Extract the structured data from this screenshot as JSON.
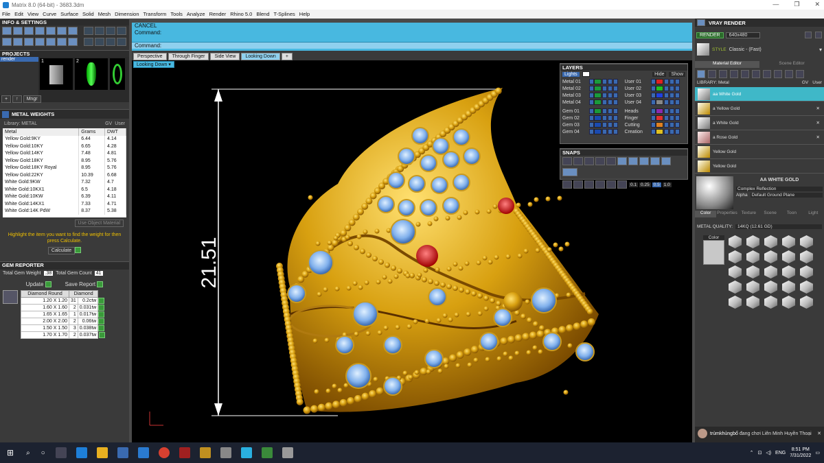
{
  "window": {
    "title": "Matrix 8.0 (64-bit) - 3683.3dm"
  },
  "menu": [
    "File",
    "Edit",
    "View",
    "Curve",
    "Surface",
    "Solid",
    "Mesh",
    "Dimension",
    "Transform",
    "Tools",
    "Analyze",
    "Render",
    "Rhino 5.0",
    "Blend",
    "T-Splines",
    "Help"
  ],
  "left": {
    "info_title": "INFO & SETTINGS",
    "projects_title": "PROJECTS",
    "project_item": "render",
    "project_thumbs": [
      "1",
      "2"
    ],
    "mngr": "Mngr",
    "metal_weights_title": "METAL WEIGHTS",
    "library_label": "Library: METAL",
    "gv": "GV",
    "user": "User",
    "columns": [
      "Metal",
      "Grams",
      "DWT"
    ],
    "rows": [
      [
        "Yellow Gold:9KY",
        "6.44",
        "4.14"
      ],
      [
        "Yellow Gold:10KY",
        "6.65",
        "4.28"
      ],
      [
        "Yellow Gold:14KY",
        "7.48",
        "4.81"
      ],
      [
        "Yellow Gold:18KY",
        "8.95",
        "5.76"
      ],
      [
        "Yellow Gold:18KY Royal",
        "8.95",
        "5.76"
      ],
      [
        "Yellow Gold:22KY",
        "10.39",
        "6.68"
      ],
      [
        "White Gold:9KW",
        "7.32",
        "4.7"
      ],
      [
        "White Gold:10KX1",
        "6.5",
        "4.18"
      ],
      [
        "White Gold:10KW",
        "6.39",
        "4.11"
      ],
      [
        "White Gold:14KX1",
        "7.33",
        "4.71"
      ],
      [
        "White Gold:14K PdW",
        "8.37",
        "5.38"
      ]
    ],
    "use_object_material": "Use Object Material",
    "highlight_text": "Highlight the item you want to find the weight for then press Calculate.",
    "calculate": "Calculate",
    "gem_reporter_title": "GEM REPORTER",
    "total_gem_weight_label": "Total Gem Weight",
    "total_gem_weight": ".38",
    "total_gem_count_label": "Total Gem Count",
    "total_gem_count": "41",
    "update": "Update",
    "save_report": "Save Report",
    "gem_columns": [
      "Diamond Round",
      "Diamond"
    ],
    "gems": [
      [
        "1.20 X 1.20",
        "31",
        "0.2ctw"
      ],
      [
        "1.60 X 1.60",
        "2",
        "0.031tw"
      ],
      [
        "1.65 X 1.65",
        "1",
        "0.017tw"
      ],
      [
        "2.00 X 2.00",
        "2",
        "0.06tw"
      ],
      [
        "1.50 X 1.50",
        "3",
        "0.038tw"
      ],
      [
        "1.70 X 1.70",
        "2",
        "0.037tw"
      ]
    ]
  },
  "command": {
    "line1": "CANCEL",
    "line2": "Command:",
    "line3": "Command:"
  },
  "viewport": {
    "tabs": [
      "Perspective",
      "Through Finger",
      "Side View",
      "Looking Down"
    ],
    "active_tab": "Looking Down",
    "dropdown": "Looking Down",
    "dimension": "21.51"
  },
  "layers": {
    "title": "LAYERS",
    "lights": "Lights",
    "hide": "Hide",
    "show": "Show",
    "left": [
      {
        "name": "Metal 01",
        "color": "#1a9a3a"
      },
      {
        "name": "Metal 02",
        "color": "#1a9a3a"
      },
      {
        "name": "Metal 03",
        "color": "#1a9a3a"
      },
      {
        "name": "Metal 04",
        "color": "#1a9a3a"
      },
      {
        "name": "Gem 01",
        "color": "#1a9a3a"
      },
      {
        "name": "Gem 02",
        "color": "#1a4ab0"
      },
      {
        "name": "Gem 03",
        "color": "#1a4ab0"
      },
      {
        "name": "Gem 04",
        "color": "#1a4ab0"
      }
    ],
    "right": [
      {
        "name": "User 01",
        "color": "#e02020"
      },
      {
        "name": "User 02",
        "color": "#20c020"
      },
      {
        "name": "User 03",
        "color": "#2040e0"
      },
      {
        "name": "User 04",
        "color": "#888888"
      },
      {
        "name": "Heads",
        "color": "#8a2ab0"
      },
      {
        "name": "Finger",
        "color": "#e03030"
      },
      {
        "name": "Cutting",
        "color": "#e08020"
      },
      {
        "name": "Creation",
        "color": "#e0c020"
      }
    ]
  },
  "snaps": {
    "title": "SNAPS",
    "values": [
      "0.1",
      "0.25",
      "0.5",
      "1.0"
    ]
  },
  "vray": {
    "title": "VRAY RENDER",
    "render": "RENDER",
    "resolution": "640x480",
    "style_label": "STYLE",
    "style_value": "Classic - (Fast)",
    "tabs": [
      "Material Editor",
      "Scene Editor"
    ],
    "library": "LIBRARY: Metal",
    "gv": "GV",
    "user": "User",
    "materials": [
      "aa White Gold",
      "a Yellow Gold",
      "a White Gold",
      "a Rose Gold",
      "Yellow Gold",
      "Yellow Gold"
    ],
    "selected_material": "AA WHITE GOLD",
    "complex_reflection": "Complex Reflection",
    "alpha": "Alpha",
    "ground": "Default Ground Plane",
    "sub_tabs": [
      "Color",
      "Properties",
      "Texture",
      "Scene",
      "Toon",
      "Light"
    ],
    "metal_quality_label": "METAL QUALITY:",
    "metal_quality_value": "14KQ",
    "metal_quality_value2": "(12.61 GD)",
    "color_label": "Color"
  },
  "notification": {
    "user": "trùmkhủngbố",
    "text": "đang chơi Liên Minh Huyền Thoại"
  },
  "taskbar": {
    "time": "8:51 PM",
    "date": "7/31/2022",
    "lang": "ENG"
  }
}
